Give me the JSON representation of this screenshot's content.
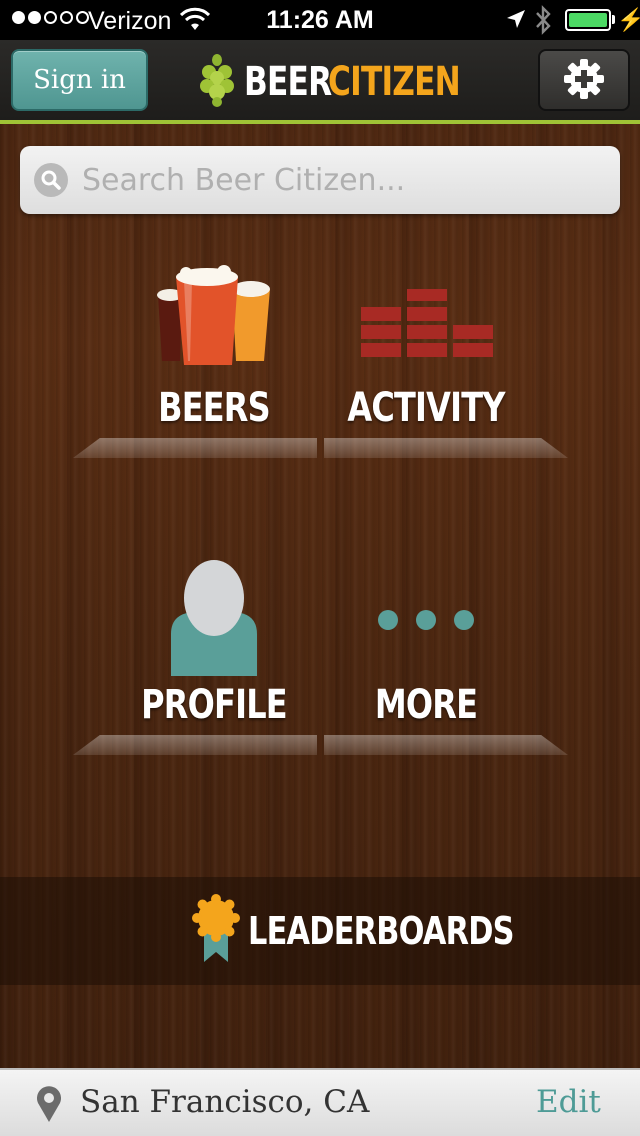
{
  "status_bar": {
    "carrier": "Verizon",
    "time": "11:26 AM",
    "battery_level": 1.0,
    "signal_bars": 2
  },
  "nav": {
    "signin_label": "Sign in",
    "brand_first": "BEER",
    "brand_second": "CITIZEN",
    "brand_accent": "#f4a51c",
    "accent_line": "#9fc336"
  },
  "search": {
    "placeholder": "Search Beer Citizen..."
  },
  "menu": {
    "beers": "BEERS",
    "activity": "ACTIVITY",
    "profile": "PROFILE",
    "more": "MORE"
  },
  "leaderboards": {
    "label": "LEADERBOARDS"
  },
  "location": {
    "city": "San Francisco, CA",
    "edit_label": "Edit"
  },
  "colors": {
    "teal": "#5a9f99",
    "activity_red": "#a52a2a"
  }
}
